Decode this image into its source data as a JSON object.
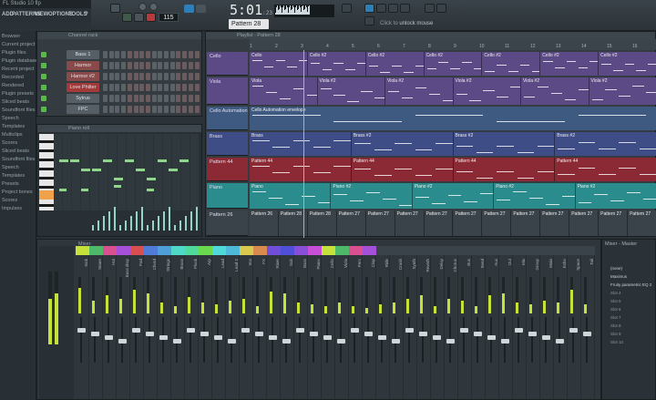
{
  "window": {
    "title": "FL Studio 10 flp"
  },
  "menu": [
    "ADD",
    "PATTERNS",
    "VIEW",
    "OPTIONS",
    "TOOLS",
    "?"
  ],
  "transport": {
    "time": "5:01",
    "time_sub": ":23",
    "tempo": "115",
    "pattern": "Pattern 28",
    "hint_label": "Click to",
    "hint_link": "unlock mouse",
    "colors": {
      "accent": "#2e7fb8",
      "record": "#b63a3a"
    }
  },
  "browser": {
    "items": [
      "Browser",
      "Current project",
      "Plugin files",
      "Plugin database",
      "Recent project",
      "Recorded",
      "Rendered",
      "Plugin presets",
      "Sliced beats",
      "Soundfont files",
      "Speech",
      "Templates",
      "Multiclips",
      "Scores",
      "Sliced beats",
      "Soundfont files",
      "Speech",
      "Templates",
      "Presets",
      "Project bones",
      "Scores",
      "Impulses"
    ]
  },
  "channel_rack": {
    "title": "Channel rack",
    "channels": [
      {
        "name": "Bass 1",
        "color": "#555f65"
      },
      {
        "name": "Harmor",
        "color": "#8a4a4a"
      },
      {
        "name": "Harmor #2",
        "color": "#8a4a4a"
      },
      {
        "name": "Love Philter",
        "color": "#a23a3a"
      },
      {
        "name": "Sytrus",
        "color": "#555f65"
      },
      {
        "name": "FPC",
        "color": "#555f65"
      }
    ]
  },
  "piano_roll": {
    "title": "Piano roll",
    "instrument": "Harmor"
  },
  "playlist": {
    "title": "Playlist - Pattern 28",
    "ruler": [
      "1",
      "2",
      "3",
      "4",
      "5",
      "6",
      "7",
      "8",
      "9",
      "10",
      "11",
      "12",
      "13",
      "14",
      "15",
      "16"
    ],
    "tracks": [
      {
        "name": "Cello",
        "color": "#5b4a86",
        "clips": [
          "Cello",
          "Cello #2",
          "Cello #2",
          "Cello #2",
          "Cello #2",
          "Cello #2",
          "Cello #2"
        ]
      },
      {
        "name": "Viola",
        "color": "#5b4a86",
        "clips": [
          "Viola",
          "Viola #2",
          "Viola #2",
          "Viola #2",
          "Viola #2",
          "Viola #2"
        ]
      },
      {
        "name": "Cello Automation",
        "color": "#3f5a80",
        "clips": [
          "Cello Automation envelope"
        ]
      },
      {
        "name": "Brass",
        "color": "#3f4d86",
        "clips": [
          "Brass",
          "Brass #2",
          "Brass #2",
          "Brass #2"
        ]
      },
      {
        "name": "Pattern 44",
        "color": "#8b2a35",
        "clips": [
          "Pattern 44",
          "Pattern 44",
          "Pattern 44",
          "Pattern 44"
        ]
      },
      {
        "name": "Piano",
        "color": "#2a8c8c",
        "clips": [
          "Piano",
          "Piano #2",
          "Piano #2",
          "Piano #2",
          "Piano #2"
        ]
      },
      {
        "name": "Pattern 26",
        "color": "#3a434a",
        "clips": [
          "Pattern 26",
          "Pattern 28",
          "Pattern 28",
          "Pattern 27",
          "Pattern 27",
          "Pattern 27",
          "Pattern 27",
          "Pattern 27",
          "Pattern 27",
          "Pattern 27",
          "Pattern 27",
          "Pattern 27",
          "Pattern 27",
          "Pattern 27"
        ]
      }
    ]
  },
  "mixer": {
    "title": "Mixer",
    "master_label": "Master",
    "strips": [
      {
        "name": "Kick",
        "level": 0.7
      },
      {
        "name": "Snare",
        "level": 0.35
      },
      {
        "name": "Hat",
        "level": 0.5
      },
      {
        "name": "Bass drop",
        "level": 0.4
      },
      {
        "name": "Pad",
        "level": 0.65
      },
      {
        "name": "Chord",
        "level": 0.55
      },
      {
        "name": "Strings",
        "level": 0.3
      },
      {
        "name": "Brass",
        "level": 0.2
      },
      {
        "name": "Pluck",
        "level": 0.45
      },
      {
        "name": "Arp",
        "level": 0.3
      },
      {
        "name": "Lead",
        "level": 0.25
      },
      {
        "name": "Lead 2",
        "level": 0.35
      },
      {
        "name": "Vox",
        "level": 0.4
      },
      {
        "name": "FX",
        "level": 0.2
      },
      {
        "name": "Riser",
        "level": 0.6
      },
      {
        "name": "Sub",
        "level": 0.55
      },
      {
        "name": "Bass",
        "level": 0.3
      },
      {
        "name": "Piano",
        "level": 0.25
      },
      {
        "name": "Cello",
        "level": 0.2
      },
      {
        "name": "Viola",
        "level": 0.3
      },
      {
        "name": "Perc",
        "level": 0.2
      },
      {
        "name": "Clap",
        "level": 0.15
      },
      {
        "name": "Ride",
        "level": 0.25
      },
      {
        "name": "Crash",
        "level": 0.3
      },
      {
        "name": "Synth",
        "level": 0.4
      },
      {
        "name": "Reverb",
        "level": 0.5
      },
      {
        "name": "Delay",
        "level": 0.2
      },
      {
        "name": "Chorus",
        "level": 0.4
      },
      {
        "name": "Bus",
        "level": 0.35
      },
      {
        "name": "Send",
        "level": 0.2
      },
      {
        "name": "Aux",
        "level": 0.5
      },
      {
        "name": "Out",
        "level": 0.55
      },
      {
        "name": "Mix",
        "level": 0.3
      },
      {
        "name": "Group",
        "level": 0.25
      },
      {
        "name": "Main",
        "level": 0.35
      },
      {
        "name": "Echo",
        "level": 0.3
      },
      {
        "name": "Space",
        "level": 0.65
      },
      {
        "name": "Tail",
        "level": 0.25
      }
    ]
  },
  "fx_panel": {
    "title": "Mixer - Master",
    "slots": [
      "(none)",
      "Maximus",
      "Fruity parametric EQ 2",
      "Slot 4",
      "Slot 5",
      "Slot 6",
      "Slot 7",
      "Slot 8",
      "Slot 9",
      "Slot 10"
    ]
  }
}
